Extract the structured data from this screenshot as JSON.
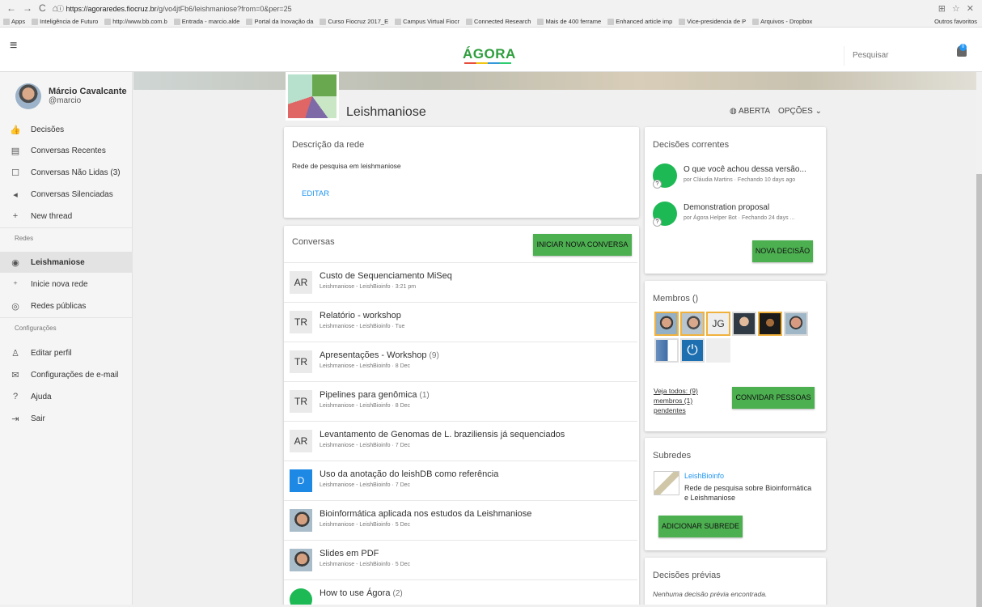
{
  "browser": {
    "url_host": "https://agoraredes.fiocruz.br",
    "url_path": "/g/vo4jtFb6/leishmaniose?from=0&per=25",
    "bookmarks": [
      "Apps",
      "Inteligência de Futuro",
      "http://www.bb.com.b",
      "Entrada - marcio.alde",
      "Portal da Inovação da",
      "Curso Fiocruz 2017_E",
      "Campus Virtual Fiocr",
      "Connected Research",
      "Mais de 400 ferrame",
      "Enhanced article imp",
      "Vice-presidencia de P",
      "Arquivos - Dropbox"
    ],
    "more_bookmarks": "Outros favoritos"
  },
  "appbar": {
    "logo": "ÁGORA",
    "search_placeholder": "Pesquisar",
    "notif_count": "0"
  },
  "user": {
    "name": "Márcio Cavalcante",
    "handle": "@marcio"
  },
  "sidebar": {
    "items": [
      {
        "icon": "thumbs-icon",
        "glyph": "👍",
        "label": "Decisões"
      },
      {
        "icon": "chat-icon",
        "glyph": "▤",
        "label": "Conversas Recentes"
      },
      {
        "icon": "unread-icon",
        "glyph": "☐",
        "label": "Conversas Não Lidas (3)"
      },
      {
        "icon": "mute-icon",
        "glyph": "◂",
        "label": "Conversas Silenciadas"
      },
      {
        "icon": "plus-icon",
        "glyph": "+",
        "label": "New thread"
      }
    ],
    "redes_header": "Redes",
    "redes": [
      {
        "icon": "network-icon",
        "glyph": "◉",
        "label": "Leishmaniose"
      },
      {
        "icon": "add-group-icon",
        "glyph": "⁺",
        "label": "Inicie nova rede"
      },
      {
        "icon": "public-icon",
        "glyph": "◎",
        "label": "Redes públicas"
      }
    ],
    "config_header": "Configurações",
    "config": [
      {
        "icon": "person-icon",
        "glyph": "♙",
        "label": "Editar perfil"
      },
      {
        "icon": "mail-icon",
        "glyph": "✉",
        "label": "Configurações de e-mail"
      },
      {
        "icon": "help-icon",
        "glyph": "?",
        "label": "Ajuda"
      },
      {
        "icon": "logout-icon",
        "glyph": "⇥",
        "label": "Sair"
      }
    ]
  },
  "network": {
    "title": "Leishmaniose",
    "privacy": "ABERTA",
    "options": "OPÇÕES"
  },
  "descricao": {
    "title": "Descrição da rede",
    "text": "Rede de pesquisa em leishmaniose",
    "edit": "EDITAR"
  },
  "conversas": {
    "title": "Conversas",
    "new_button": "INICIAR NOVA CONVERSA",
    "items": [
      {
        "avatar": "AR",
        "style": "",
        "title": "Custo de Sequenciamento MiSeq",
        "count": "",
        "meta": "Leishmaniose - LeishBioinfo · 3:21 pm"
      },
      {
        "avatar": "TR",
        "style": "",
        "title": "Relatório - workshop",
        "count": "",
        "meta": "Leishmaniose - LeishBioinfo · Tue"
      },
      {
        "avatar": "TR",
        "style": "",
        "title": "Apresentações - Workshop",
        "count": "(9)",
        "meta": "Leishmaniose - LeishBioinfo · 8 Dec"
      },
      {
        "avatar": "TR",
        "style": "",
        "title": "Pipelines para genômica",
        "count": "(1)",
        "meta": "Leishmaniose - LeishBioinfo · 8 Dec"
      },
      {
        "avatar": "AR",
        "style": "",
        "title": "Levantamento de Genomas de L. braziliensis já sequenciados",
        "count": "",
        "meta": "Leishmaniose - LeishBioinfo · 7 Dec"
      },
      {
        "avatar": "D",
        "style": "blue",
        "title": "Uso da anotação do leishDB como referência",
        "count": "",
        "meta": "Leishmaniose - LeishBioinfo · 7 Dec"
      },
      {
        "avatar": "",
        "style": "photo",
        "title": "Bioinformática aplicada nos estudos da Leishmaniose",
        "count": "",
        "meta": "Leishmaniose - LeishBioinfo · 5 Dec"
      },
      {
        "avatar": "",
        "style": "photo",
        "title": "Slides em PDF",
        "count": "",
        "meta": "Leishmaniose - LeishBioinfo · 5 Dec"
      },
      {
        "avatar": "",
        "style": "green",
        "title": "How to use Ágora",
        "count": "(2)",
        "meta": ""
      }
    ]
  },
  "decisoes": {
    "title": "Decisões correntes",
    "items": [
      {
        "title": "O que você achou dessa versão...",
        "meta": "por Cláudia Martins · Fechando 10 days ago"
      },
      {
        "title": "Demonstration proposal",
        "meta": "por Ágora Helper Bot · Fechando 24 days ..."
      }
    ],
    "button": "NOVA DECISÃO"
  },
  "membros": {
    "title": "Membros ()",
    "initials": "JG",
    "link1": "Veja todos: (9)",
    "link2": "membros (1)",
    "link3": "pendentes",
    "button": "CONVIDAR PESSOAS"
  },
  "subredes": {
    "title": "Subredes",
    "name": "LeishBioinfo",
    "desc1": "Rede de pesquisa sobre Bioinformática",
    "desc2": "e Leishmaniose",
    "button": "ADICIONAR SUBREDE"
  },
  "previas": {
    "title": "Decisões prévias",
    "empty": "Nenhuma decisão prévia encontrada."
  }
}
